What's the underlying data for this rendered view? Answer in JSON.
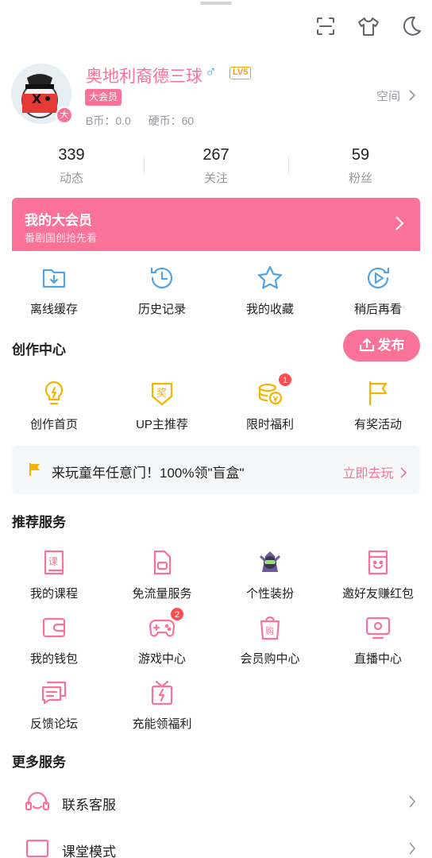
{
  "header": {
    "icons": [
      "scan-icon",
      "tshirt-icon",
      "night-mode-icon"
    ]
  },
  "profile": {
    "username": "奥地利裔德三球",
    "gender": "♂",
    "level": "LV5",
    "vip_label": "大会员",
    "vip_dot": "大",
    "b_coin": "B币：0.0",
    "hard_coin": "硬币：60",
    "space_label": "空间"
  },
  "stats": [
    {
      "value": "339",
      "label": "动态"
    },
    {
      "value": "267",
      "label": "关注"
    },
    {
      "value": "59",
      "label": "粉丝"
    }
  ],
  "vip_banner": {
    "title": "我的大会员",
    "subtitle": "番剧国创抢先看"
  },
  "quick": [
    {
      "label": "离线缓存",
      "icon": "download-icon"
    },
    {
      "label": "历史记录",
      "icon": "history-icon"
    },
    {
      "label": "我的收藏",
      "icon": "star-icon"
    },
    {
      "label": "稍后再看",
      "icon": "watch-later-icon"
    }
  ],
  "creation": {
    "title": "创作中心",
    "publish_label": "发布",
    "items": [
      {
        "label": "创作首页",
        "icon": "bulb-icon",
        "badge": ""
      },
      {
        "label": "UP主推荐",
        "icon": "award-icon",
        "badge": ""
      },
      {
        "label": "限时福利",
        "icon": "coins-icon",
        "badge": "1"
      },
      {
        "label": "有奖活动",
        "icon": "flag-icon",
        "badge": ""
      }
    ]
  },
  "promo": {
    "text": "来玩童年任意门！100%领\"盲盒\"",
    "action": "立即去玩"
  },
  "recommend": {
    "title": "推荐服务",
    "items": [
      {
        "label": "我的课程",
        "icon": "course-icon",
        "badge": ""
      },
      {
        "label": "免流量服务",
        "icon": "sim-card-icon",
        "badge": ""
      },
      {
        "label": "个性装扮",
        "icon": "dressup-icon",
        "badge": ""
      },
      {
        "label": "邀好友赚红包",
        "icon": "invite-icon",
        "badge": ""
      },
      {
        "label": "我的钱包",
        "icon": "wallet-icon",
        "badge": ""
      },
      {
        "label": "游戏中心",
        "icon": "gamepad-icon",
        "badge": "2"
      },
      {
        "label": "会员购中心",
        "icon": "shopping-bag-icon",
        "badge": ""
      },
      {
        "label": "直播中心",
        "icon": "live-tv-icon",
        "badge": ""
      },
      {
        "label": "反馈论坛",
        "icon": "feedback-icon",
        "badge": ""
      },
      {
        "label": "充能领福利",
        "icon": "gift-icon",
        "badge": ""
      }
    ]
  },
  "more": {
    "title": "更多服务",
    "items": [
      {
        "label": "联系客服",
        "icon": "headset-icon"
      },
      {
        "label": "课堂模式",
        "icon": "classroom-icon"
      }
    ]
  },
  "colors": {
    "accent": "#fb7299",
    "blue": "#4fa3e6",
    "gold": "#f5b400"
  }
}
